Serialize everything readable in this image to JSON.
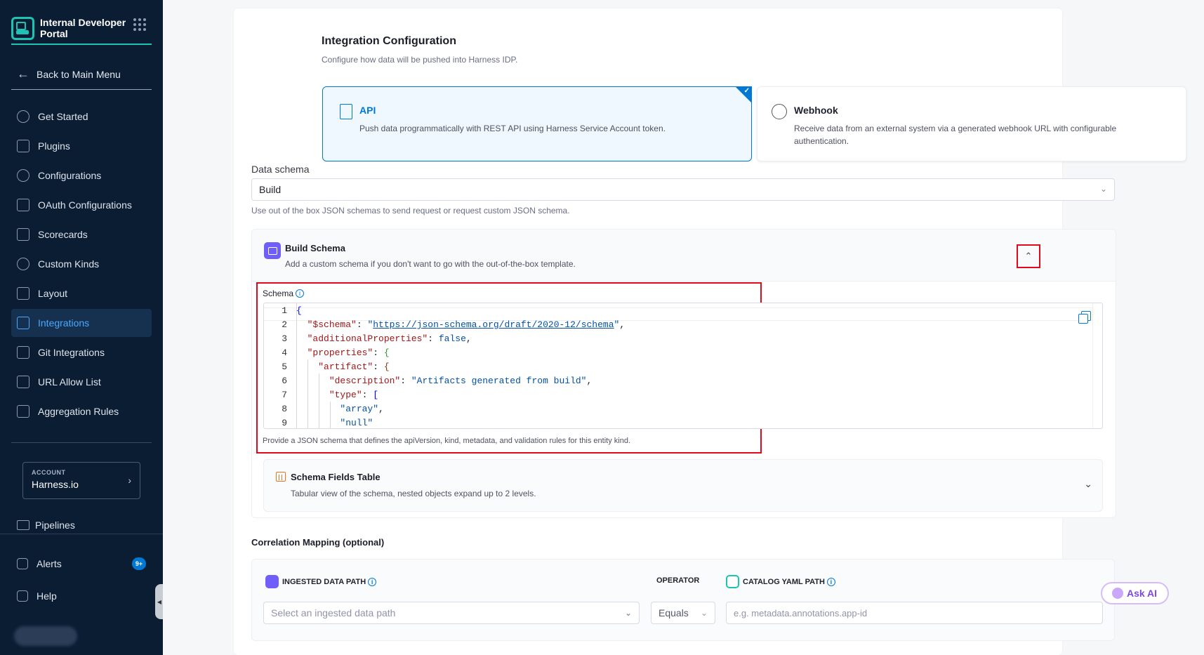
{
  "app": {
    "title": "Internal Developer Portal"
  },
  "sidebar": {
    "back_label": "Back to Main Menu",
    "items": [
      {
        "label": "Get Started",
        "icon": "start-icon"
      },
      {
        "label": "Plugins",
        "icon": "plugin-icon"
      },
      {
        "label": "Configurations",
        "icon": "gear-icon"
      },
      {
        "label": "OAuth Configurations",
        "icon": "lock-icon"
      },
      {
        "label": "Scorecards",
        "icon": "scorecard-icon"
      },
      {
        "label": "Custom Kinds",
        "icon": "settings-icon"
      },
      {
        "label": "Layout",
        "icon": "layout-icon"
      },
      {
        "label": "Integrations",
        "icon": "integration-icon",
        "active": true
      },
      {
        "label": "Git Integrations",
        "icon": "git-icon"
      },
      {
        "label": "URL Allow List",
        "icon": "link-icon"
      },
      {
        "label": "Aggregation Rules",
        "icon": "aggregation-icon"
      }
    ],
    "account_label": "ACCOUNT",
    "account_name": "Harness.io",
    "pipelines": "Pipelines",
    "alerts": "Alerts",
    "alerts_badge": "9+",
    "help": "Help"
  },
  "main": {
    "title": "Integration Configuration",
    "subtitle": "Configure how data will be pushed into Harness IDP.",
    "options": [
      {
        "title": "API",
        "desc": "Push data programmatically with REST API using Harness Service Account token.",
        "selected": true
      },
      {
        "title": "Webhook",
        "desc": "Receive data from an external system via a generated webhook URL with configurable authentication.",
        "selected": false
      }
    ],
    "data_schema_label": "Data schema",
    "data_schema_value": "Build",
    "data_schema_hint": "Use out of the box JSON schemas to send request or request custom JSON schema.",
    "build_schema": {
      "title": "Build Schema",
      "desc": "Add a custom schema if you don't want to go with the out-of-the-box template."
    },
    "schema_label": "Schema",
    "schema_hint": "Provide a JSON schema that defines the apiVersion, kind, metadata, and validation rules for this entity kind.",
    "code_lines": [
      {
        "n": "1",
        "text": "{"
      },
      {
        "n": "2",
        "text": "  \"$schema\": \"https://json-schema.org/draft/2020-12/schema\","
      },
      {
        "n": "3",
        "text": "  \"additionalProperties\": false,"
      },
      {
        "n": "4",
        "text": "  \"properties\": {"
      },
      {
        "n": "5",
        "text": "    \"artifact\": {"
      },
      {
        "n": "6",
        "text": "      \"description\": \"Artifacts generated from build\","
      },
      {
        "n": "7",
        "text": "      \"type\": ["
      },
      {
        "n": "8",
        "text": "        \"array\","
      },
      {
        "n": "9",
        "text": "        \"null\""
      }
    ],
    "fields_table": {
      "title": "Schema Fields Table",
      "desc": "Tabular view of the schema, nested objects expand up to 2 levels."
    },
    "correlation": {
      "title": "Correlation Mapping (optional)",
      "col_ingested": "INGESTED DATA PATH",
      "col_operator": "OPERATOR",
      "col_catalog": "CATALOG YAML PATH",
      "ingested_placeholder": "Select an ingested data path",
      "operator_value": "Equals",
      "catalog_placeholder": "e.g. metadata.annotations.app-id"
    },
    "ask_ai": "Ask AI"
  },
  "colors": {
    "sidebar_bg": "#0b1d33",
    "accent": "#0278d5",
    "brand": "#1dc3b3",
    "highlight": "#e00a1d"
  }
}
